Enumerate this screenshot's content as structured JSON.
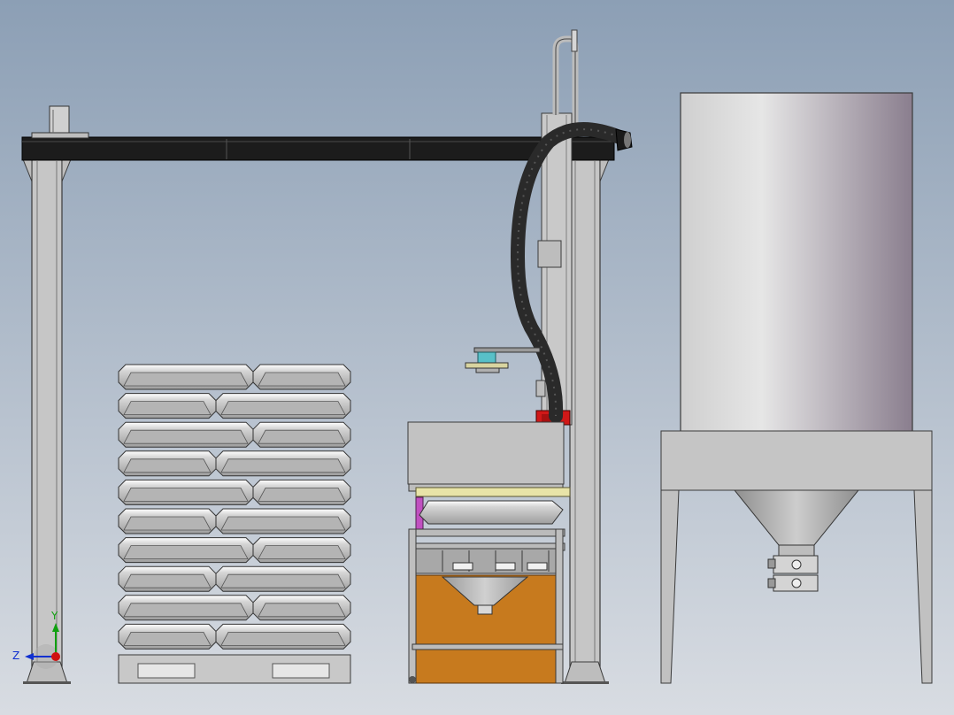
{
  "viewport": {
    "background_top": "#8c9fb5",
    "background_bottom": "#d8dce2"
  },
  "palette": {
    "frame_dark": "#1c1c1c",
    "steel_light": "#c9c9c9",
    "steel_mid": "#a9a9a9",
    "steel_outline": "#3a3a3a",
    "bag_face": "#b4b4b4",
    "bag_highlight": "#ffffff",
    "hose": "#2a2a2a",
    "silo_light": "#e2e2e2",
    "silo_dark": "#8a7e8e",
    "orange_bin": "#c77a1e",
    "red_part": "#d01818",
    "yellow_bar": "#e8e4a8",
    "magenta_part": "#c050c0",
    "cyan_part": "#58c0c8"
  },
  "triad": {
    "x_color": "#d01010",
    "y_color": "#10a010",
    "z_color": "#1030d0",
    "y_label": "Y",
    "z_label": "Z"
  }
}
